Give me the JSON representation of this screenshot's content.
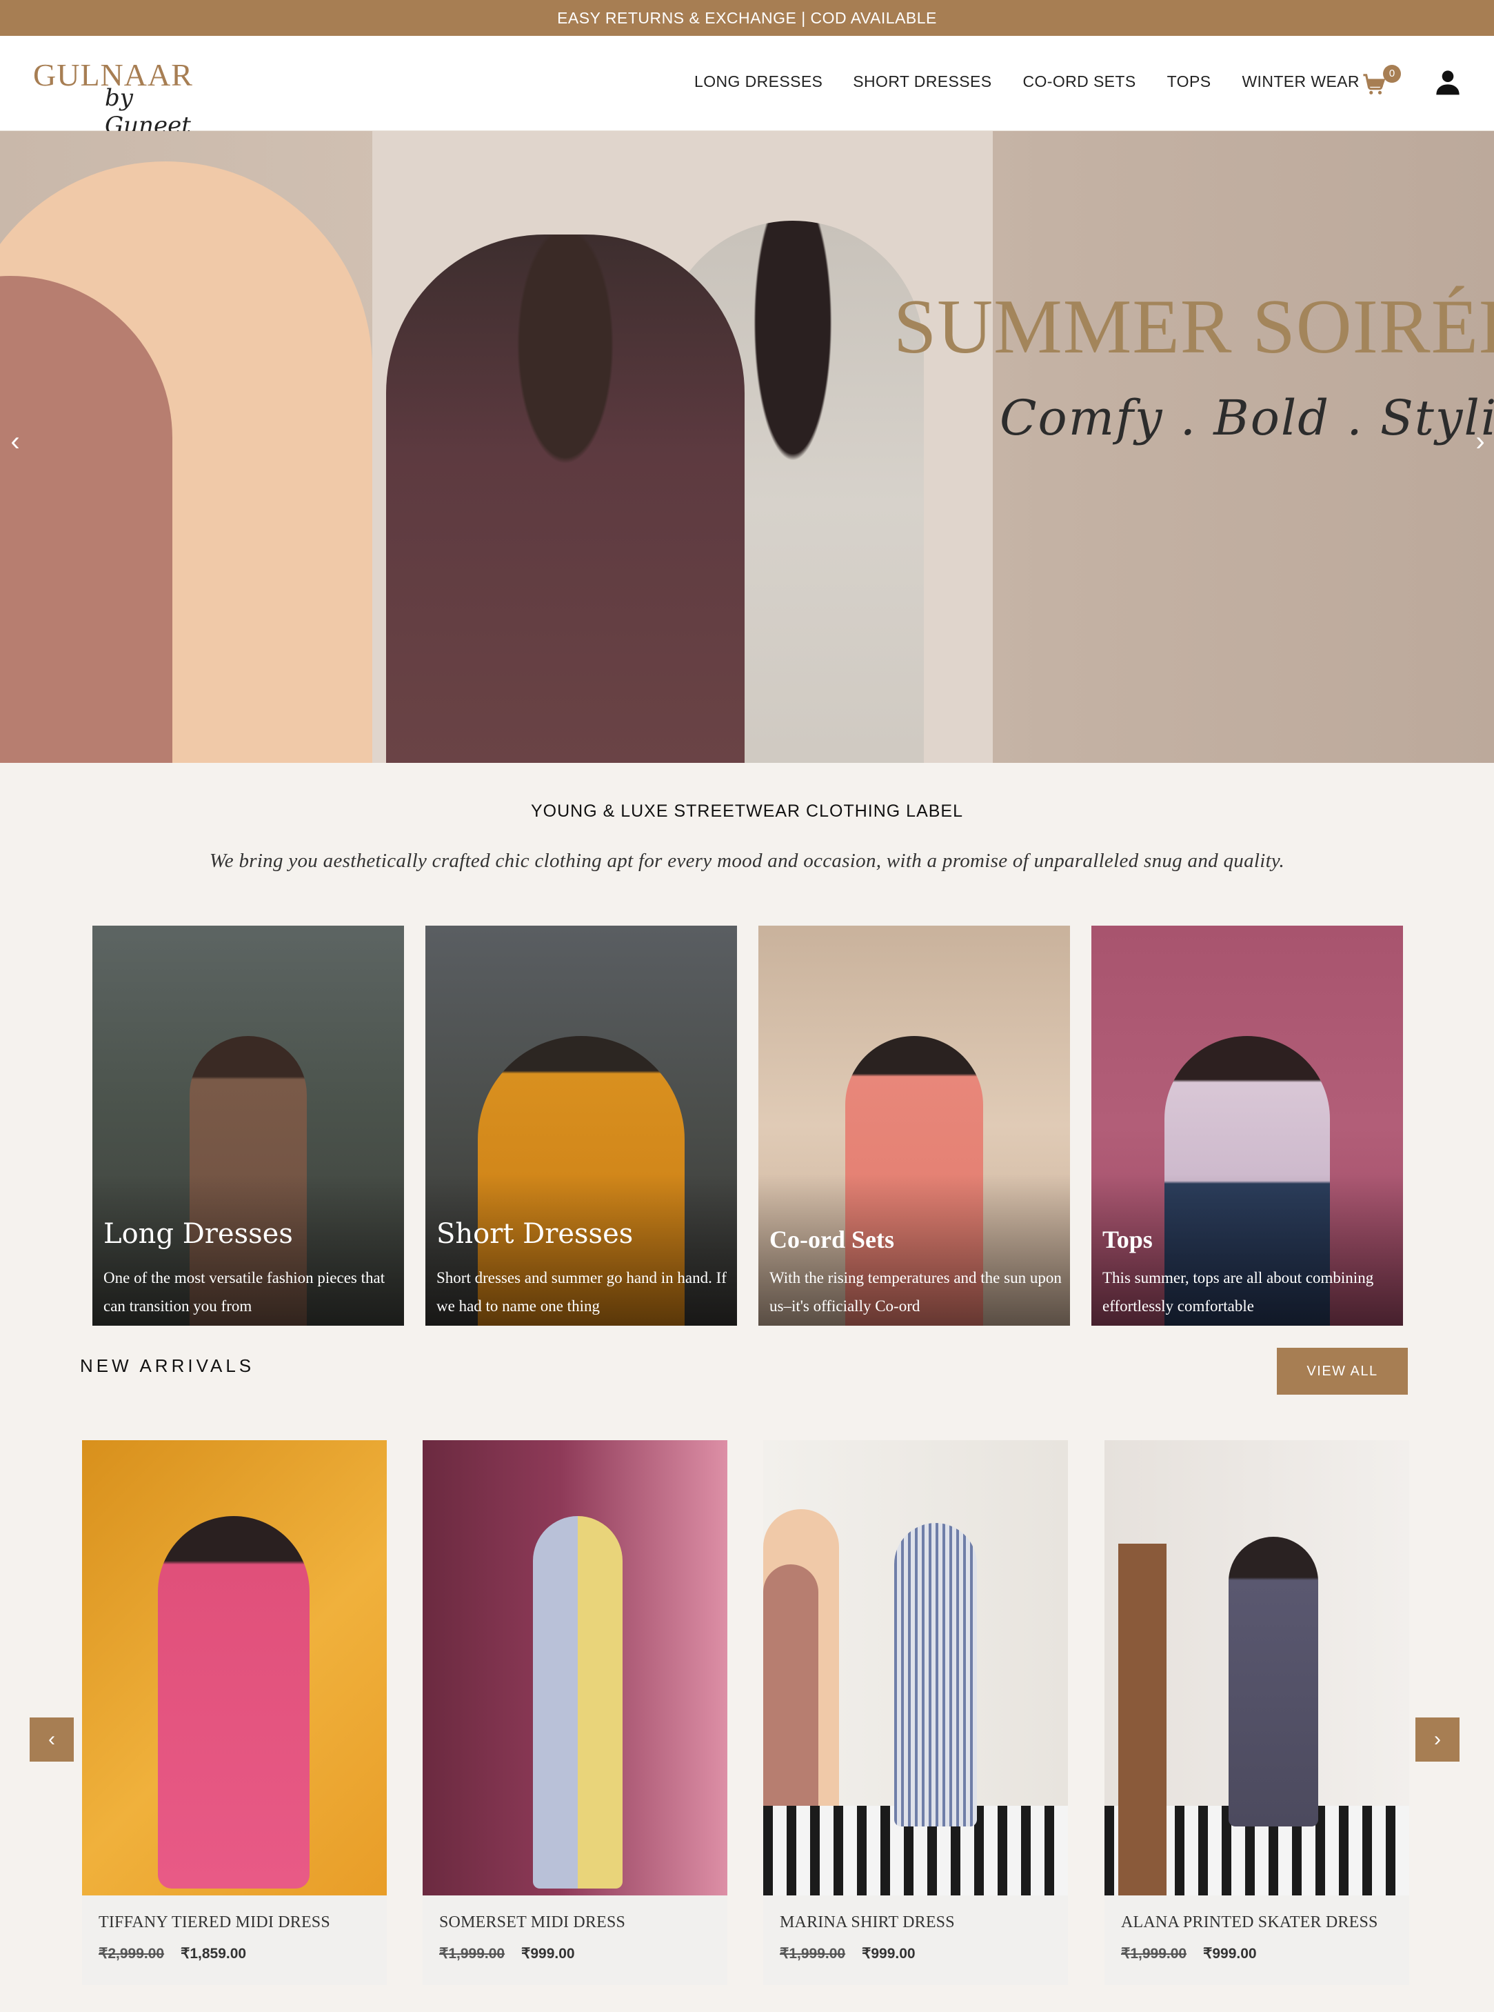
{
  "announcement": "EASY RETURNS & EXCHANGE | COD AVAILABLE",
  "logo": {
    "main": "GULNAAR",
    "sub": "by Guneet"
  },
  "nav": [
    "LONG DRESSES",
    "SHORT DRESSES",
    "CO-ORD SETS",
    "TOPS",
    "WINTER WEAR"
  ],
  "cart": {
    "count": "0"
  },
  "hero": {
    "title": "SUMMER SOIRÉE",
    "subtitle": "Comfy . Bold . Stylish"
  },
  "intro": {
    "heading": "YOUNG & LUXE STREETWEAR CLOTHING LABEL",
    "text": "We bring you aesthetically crafted chic clothing apt for every mood and occasion, with a promise of unparalleled snug and quality."
  },
  "categories": [
    {
      "title": "Long Dresses",
      "desc": "One of the most versatile fashion pieces that can transition you from"
    },
    {
      "title": "Short Dresses",
      "desc": "Short dresses and summer go hand in hand. If we had to name one thing"
    },
    {
      "title": "Co-ord Sets",
      "desc": "With the rising temperatures and the sun upon us–it's officially Co-ord"
    },
    {
      "title": "Tops",
      "desc": "This summer, tops are all about combining effortlessly comfortable"
    }
  ],
  "new_arrivals": {
    "heading": "NEW ARRIVALS",
    "view_all": "VIEW ALL",
    "products": [
      {
        "name": "TIFFANY TIERED MIDI DRESS",
        "old_price": "₹2,999.00",
        "new_price": "₹1,859.00"
      },
      {
        "name": "SOMERSET MIDI DRESS",
        "old_price": "₹1,999.00",
        "new_price": "₹999.00"
      },
      {
        "name": "MARINA SHIRT DRESS",
        "old_price": "₹1,999.00",
        "new_price": "₹999.00"
      },
      {
        "name": "ALANA PRINTED SKATER DRESS",
        "old_price": "₹1,999.00",
        "new_price": "₹999.00"
      }
    ]
  },
  "colors": {
    "brand": "#a77e53",
    "background": "#f5f2ee"
  }
}
